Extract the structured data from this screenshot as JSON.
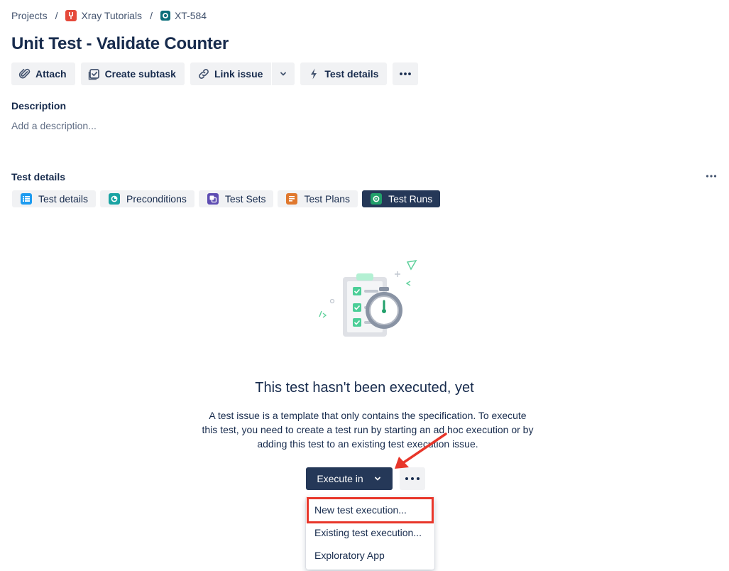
{
  "breadcrumb": {
    "root": "Projects",
    "project": "Xray Tutorials",
    "issue_key": "XT-584",
    "separator": "/"
  },
  "issue": {
    "title": "Unit Test - Validate Counter"
  },
  "toolbar": {
    "attach": "Attach",
    "create_subtask": "Create subtask",
    "link_issue": "Link issue",
    "test_details": "Test details",
    "more_icon": "ellipsis-icon"
  },
  "description": {
    "heading": "Description",
    "placeholder": "Add a description..."
  },
  "test_details": {
    "heading": "Test details",
    "tabs": [
      {
        "label": "Test details",
        "icon": "list-icon",
        "color": "#1d9bf0"
      },
      {
        "label": "Preconditions",
        "icon": "precondition-icon",
        "color": "#1aa3a3"
      },
      {
        "label": "Test Sets",
        "icon": "test-set-icon",
        "color": "#5e4db2"
      },
      {
        "label": "Test Plans",
        "icon": "test-plan-icon",
        "color": "#e0782e"
      },
      {
        "label": "Test Runs",
        "icon": "test-run-icon",
        "color": "#22a06b",
        "active": true
      }
    ]
  },
  "empty_state": {
    "title": "This test hasn't been executed, yet",
    "text": "A test issue is a template that only contains the specification. To execute this test, you need to create a test run by starting an ad hoc execution or by adding this test to an existing test execution issue.",
    "illustration_icon": "clipboard-stopwatch-icon"
  },
  "execute": {
    "label": "Execute in",
    "menu": [
      "New test execution...",
      "Existing test execution...",
      "Exploratory App"
    ]
  },
  "colors": {
    "primary_dark": "#253858",
    "button_bg": "#f1f2f4",
    "annotation_red": "#e8362a",
    "text": "#172b4d",
    "subtle_text": "#626f86"
  }
}
